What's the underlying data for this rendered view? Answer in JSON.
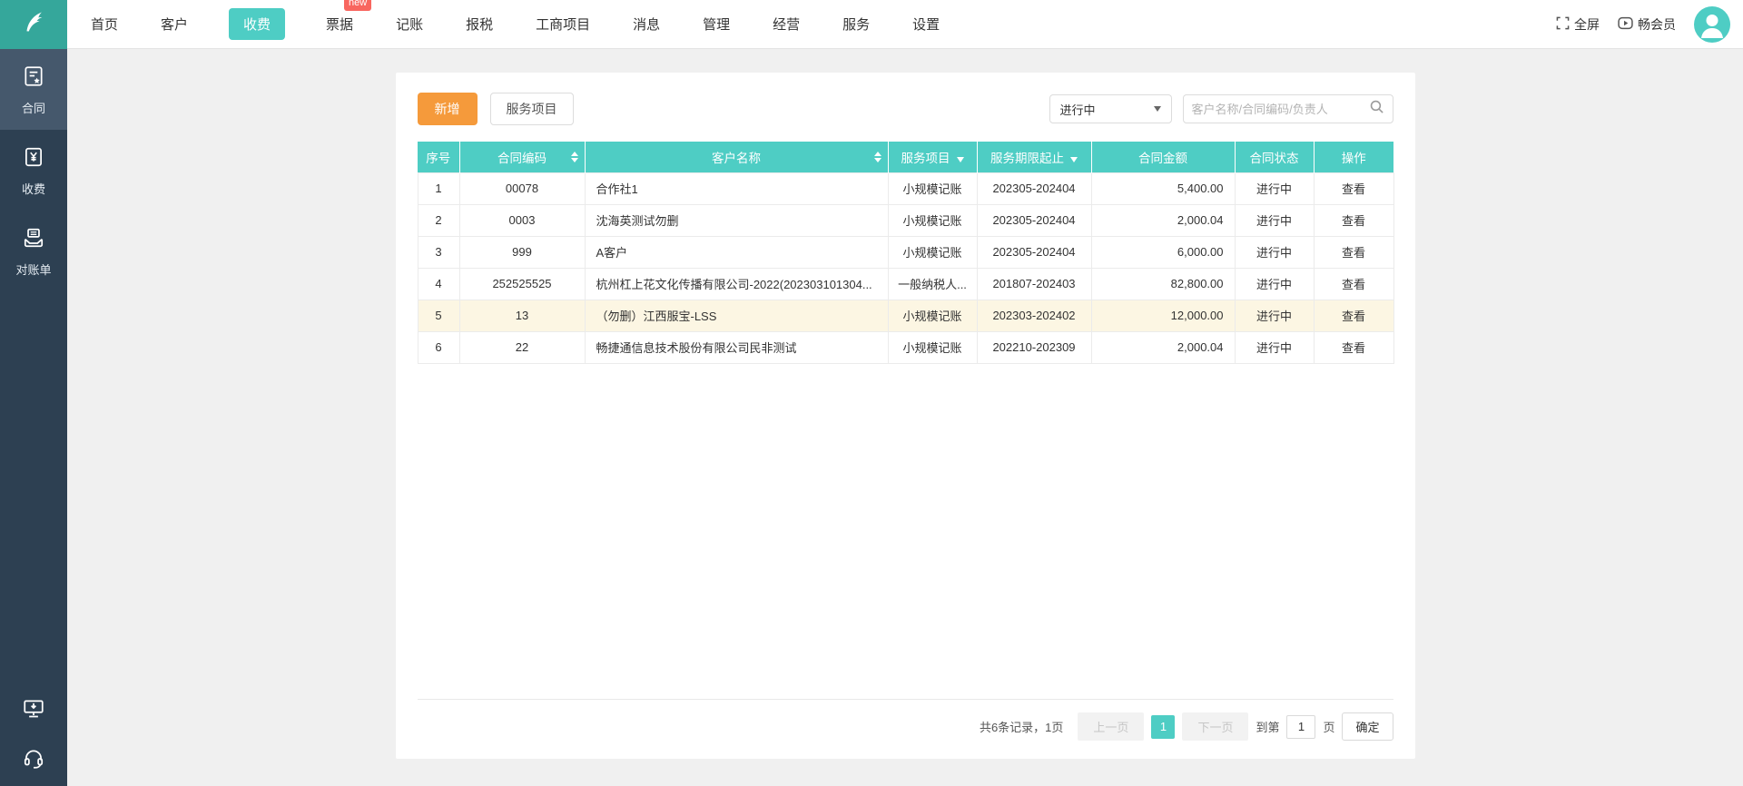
{
  "topnav": {
    "items": [
      {
        "label": "首页",
        "active": false
      },
      {
        "label": "客户",
        "active": false
      },
      {
        "label": "收费",
        "active": true
      },
      {
        "label": "票据",
        "active": false,
        "badge": "new"
      },
      {
        "label": "记账",
        "active": false
      },
      {
        "label": "报税",
        "active": false
      },
      {
        "label": "工商项目",
        "active": false
      },
      {
        "label": "消息",
        "active": false
      },
      {
        "label": "管理",
        "active": false
      },
      {
        "label": "经营",
        "active": false
      },
      {
        "label": "服务",
        "active": false
      },
      {
        "label": "设置",
        "active": false
      }
    ],
    "fullscreen_label": "全屏",
    "member_label": "畅会员",
    "icons": [
      "fullscreen-icon",
      "member-play-icon",
      "avatar"
    ]
  },
  "sidebar": {
    "items": [
      {
        "label": "合同",
        "icon": "contract-icon",
        "active": true
      },
      {
        "label": "收费",
        "icon": "fee-icon",
        "active": false
      },
      {
        "label": "对账单",
        "icon": "statement-icon",
        "active": false
      }
    ],
    "bottom_icons": [
      "client-download-icon",
      "support-icon"
    ]
  },
  "toolbar": {
    "add_label": "新增",
    "service_label": "服务项目",
    "status_filter_value": "进行中",
    "search_placeholder": "客户名称/合同编码/负责人",
    "search_icon": "search-icon"
  },
  "table": {
    "columns": [
      {
        "label": "序号"
      },
      {
        "label": "合同编码",
        "sortable": true
      },
      {
        "label": "客户名称",
        "sortable": true
      },
      {
        "label": "服务项目",
        "filterable": true
      },
      {
        "label": "服务期限起止",
        "filterable": true
      },
      {
        "label": "合同金额"
      },
      {
        "label": "合同状态"
      },
      {
        "label": "操作"
      }
    ],
    "rows": [
      {
        "seq": "1",
        "code": "00078",
        "customer": "合作社1",
        "service": "小规模记账",
        "period": "202305-202404",
        "amount": "5,400.00",
        "status": "进行中",
        "action": "查看",
        "highlighted": false
      },
      {
        "seq": "2",
        "code": "0003",
        "customer": "沈海英测试勿删",
        "service": "小规模记账",
        "period": "202305-202404",
        "amount": "2,000.04",
        "status": "进行中",
        "action": "查看",
        "highlighted": false
      },
      {
        "seq": "3",
        "code": "999",
        "customer": "A客户",
        "service": "小规模记账",
        "period": "202305-202404",
        "amount": "6,000.00",
        "status": "进行中",
        "action": "查看",
        "highlighted": false
      },
      {
        "seq": "4",
        "code": "252525525",
        "customer": "杭州杠上花文化传播有限公司-2022(202303101304...",
        "service": "一般纳税人...",
        "period": "201807-202403",
        "amount": "82,800.00",
        "status": "进行中",
        "action": "查看",
        "highlighted": false
      },
      {
        "seq": "5",
        "code": "13",
        "customer": "（勿删）江西服宝-LSS",
        "service": "小规模记账",
        "period": "202303-202402",
        "amount": "12,000.00",
        "status": "进行中",
        "action": "查看",
        "highlighted": true
      },
      {
        "seq": "6",
        "code": "22",
        "customer": "畅捷通信息技术股份有限公司民非测试",
        "service": "小规模记账",
        "period": "202210-202309",
        "amount": "2,000.04",
        "status": "进行中",
        "action": "查看",
        "highlighted": false
      }
    ]
  },
  "pagination": {
    "summary": "共6条记录，1页",
    "prev_label": "上一页",
    "current_page": "1",
    "next_label": "下一页",
    "goto_prefix": "到第",
    "goto_value": "1",
    "goto_suffix": "页",
    "confirm_label": "确定"
  },
  "colors": {
    "accent_teal": "#4ecdc4",
    "logo_teal": "#35a79b",
    "sidebar_bg": "#2d4052",
    "sidebar_active_bg": "#45586c",
    "button_orange": "#f59a3b",
    "badge_red": "#f8665f",
    "row_highlight": "#fcf6e3"
  }
}
